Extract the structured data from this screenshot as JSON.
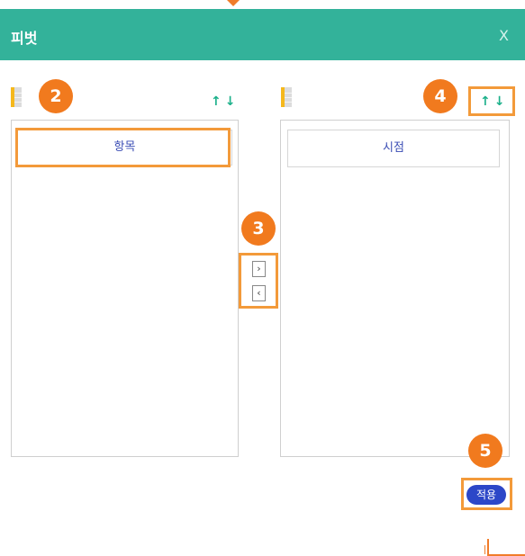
{
  "dialog": {
    "title": "피벗",
    "close_label": "X"
  },
  "left_panel": {
    "sort_label": "↑↓",
    "items": [
      "항목"
    ]
  },
  "right_panel": {
    "sort_label": "↑↓",
    "items": [
      "시점"
    ]
  },
  "move_buttons": {
    "move_right": "›",
    "move_left": "‹"
  },
  "apply_button": {
    "label": "적용"
  },
  "callouts": [
    "2",
    "3",
    "4",
    "5"
  ],
  "colors": {
    "header": "#33b29a",
    "accent_orange": "#f17a1e",
    "apply_button": "#2c47c8",
    "sort_arrows": "#1bb08a"
  }
}
